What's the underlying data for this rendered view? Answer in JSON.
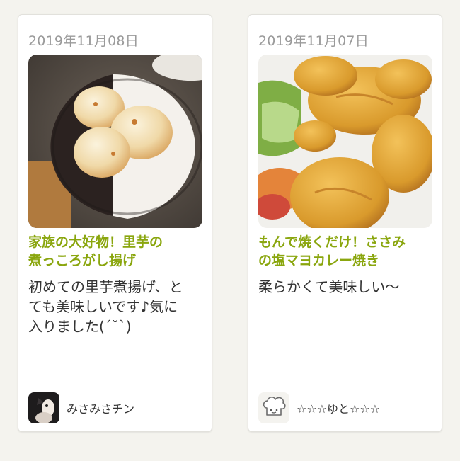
{
  "colors": {
    "background": "#f4f3ee",
    "card": "#ffffff",
    "date_text": "#9a9a9a",
    "title_text": "#8aa60e",
    "body_text": "#333333"
  },
  "reports": [
    {
      "date": "2019年11月08日",
      "photo_icon": "fried-taro-photo",
      "title_line1": "家族の大好物！里芋の",
      "title_line2": "煮っころがし揚げ",
      "comment_line1": "初めての里芋煮揚げ、と",
      "comment_line2": "ても美味しいです♪気に",
      "comment_line3": "入りました(´˘`)",
      "author_avatar_icon": "user-photo-avatar",
      "author_name": "みさみさチン"
    },
    {
      "date": "2019年11月07日",
      "photo_icon": "curry-chicken-photo",
      "title_line1": "もんで焼くだけ！ささみ",
      "title_line2": "の塩マヨカレー焼き",
      "comment_line1": "柔らかくて美味しい〜",
      "author_avatar_icon": "chef-hat-default-avatar",
      "author_name": "☆☆☆ゆと☆☆☆"
    }
  ]
}
